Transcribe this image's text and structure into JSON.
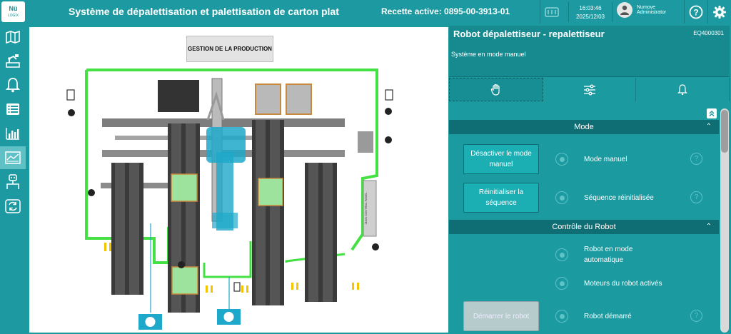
{
  "app": {
    "logo_text": "Nü",
    "logo_sub": "LOGIX",
    "title": "Système de dépalettisation et palettisation de carton plat",
    "recipe": "Recette active: 0895-00-3913-01",
    "time": "16:03:46",
    "date": "2025/12/03",
    "user_name": "Numove",
    "user_role": "Administrator"
  },
  "sidebar": {
    "items": [
      "map-icon",
      "robot-cell-icon",
      "bell-icon",
      "list-icon",
      "bar-chart-icon",
      "synoptic-icon",
      "operator-icon",
      "sync-icon"
    ],
    "active_index": 5
  },
  "synoptic": {
    "production_button": "GESTION DE LA PRODUCTION",
    "panel_label": "MAIN CONTROL PANEL"
  },
  "panel": {
    "title": "Robot dépalettiseur - repalettiseur",
    "equipment_id": "EQ4000301",
    "status": "Système en mode manuel",
    "tabs": [
      {
        "icon": "hand-icon",
        "active": true
      },
      {
        "icon": "sliders-icon",
        "active": false
      },
      {
        "icon": "bell-icon",
        "active": false
      }
    ]
  },
  "sections": {
    "mode": {
      "title": "Mode",
      "rows": [
        {
          "button": "Désactiver le mode manuel",
          "label": "Mode manuel"
        },
        {
          "button": "Réinitialiser la séquence",
          "label": "Séquence réinitialisée"
        }
      ]
    },
    "robot": {
      "title": "Contrôle du Robot",
      "rows": [
        {
          "label": "Robot en mode automatique"
        },
        {
          "label": "Moteurs du robot activés"
        },
        {
          "button": "Démarrer le robot",
          "label": "Robot démarré"
        }
      ]
    }
  },
  "colors": {
    "accent": "#1d9aa1",
    "dark": "#0f6e74",
    "conveyor_outline": "#44e044",
    "robot": "#1ea8c9"
  }
}
